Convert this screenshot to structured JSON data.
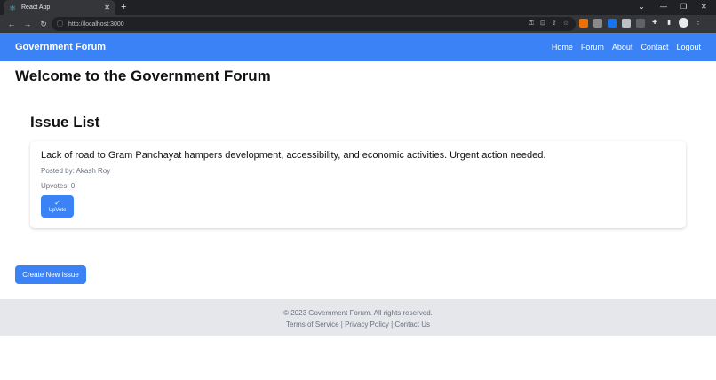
{
  "browser": {
    "tab_title": "React App",
    "url": "http://localhost:3000"
  },
  "navbar": {
    "brand": "Government Forum",
    "links": [
      "Home",
      "Forum",
      "About",
      "Contact",
      "Logout"
    ]
  },
  "page": {
    "heading": "Welcome to the Government Forum",
    "list_title": "Issue List"
  },
  "issues": [
    {
      "title": "Lack of road to Gram Panchayat hampers development, accessibility, and economic activities. Urgent action needed.",
      "posted_by": "Posted by: Akash Roy",
      "upvotes": "Upvotes: 0",
      "upvote_label": "UpVote"
    }
  ],
  "create_button": "Create New Issue",
  "footer": {
    "copyright": "© 2023 Government Forum. All rights reserved.",
    "links": [
      "Terms of Service",
      "Privacy Policy",
      "Contact Us"
    ],
    "separator": " | "
  },
  "colors": {
    "primary": "#3b82f6",
    "footer_bg": "#e5e7eb",
    "chrome_dark": "#202124"
  }
}
